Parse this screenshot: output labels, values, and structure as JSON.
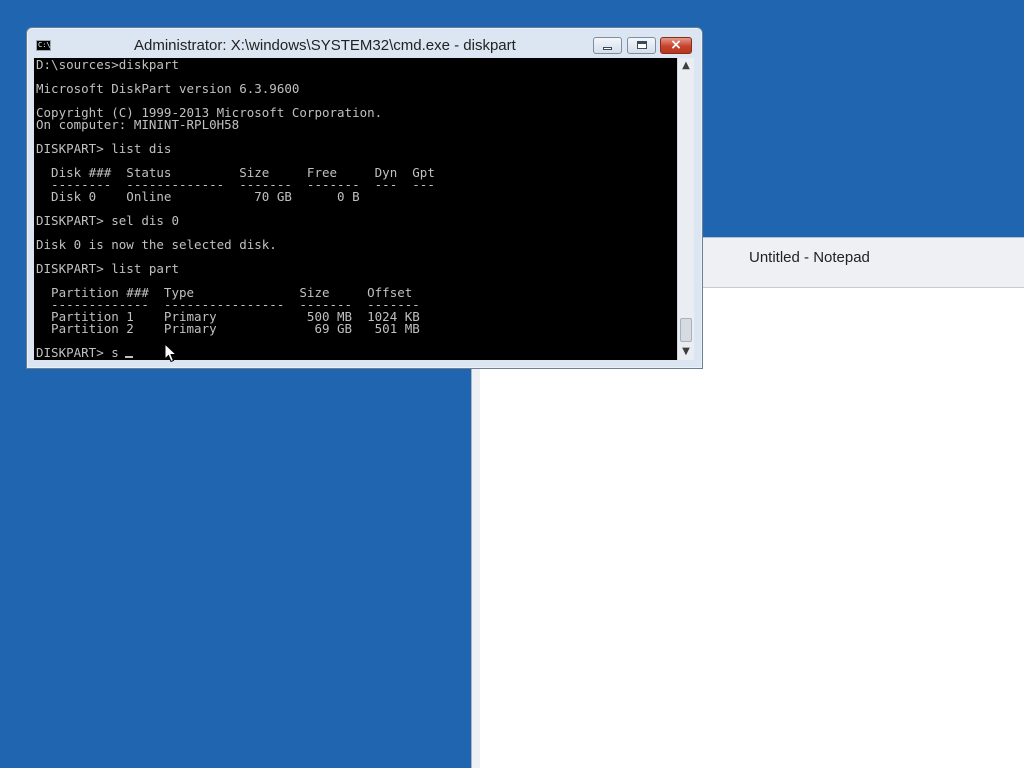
{
  "cmd": {
    "title": "Administrator: X:\\windows\\SYSTEM32\\cmd.exe - diskpart",
    "app_icon": "C:\\",
    "console_lines": [
      "D:\\sources>diskpart",
      "",
      "Microsoft DiskPart version 6.3.9600",
      "",
      "Copyright (C) 1999-2013 Microsoft Corporation.",
      "On computer: MININT-RPL0H58",
      "",
      "DISKPART> list dis",
      "",
      "  Disk ###  Status         Size     Free     Dyn  Gpt",
      "  --------  -------------  -------  -------  ---  ---",
      "  Disk 0    Online           70 GB      0 B",
      "",
      "DISKPART> sel dis 0",
      "",
      "Disk 0 is now the selected disk.",
      "",
      "DISKPART> list part",
      "",
      "  Partition ###  Type              Size     Offset",
      "  -------------  ----------------  -------  -------",
      "  Partition 1    Primary            500 MB  1024 KB",
      "  Partition 2    Primary             69 GB   501 MB",
      "",
      "DISKPART> s"
    ],
    "buttons": {
      "minimize": "minimize-icon",
      "maximize": "maximize-icon",
      "close": "×"
    },
    "scrollbar": {
      "up": "▲",
      "down": "▼"
    }
  },
  "notepad": {
    "title": "Untitled - Notepad"
  },
  "colors": {
    "desktop": "#1f65b0",
    "console_bg": "#000000",
    "console_fg": "#c0c0c0",
    "close_button": "#c6432c"
  }
}
